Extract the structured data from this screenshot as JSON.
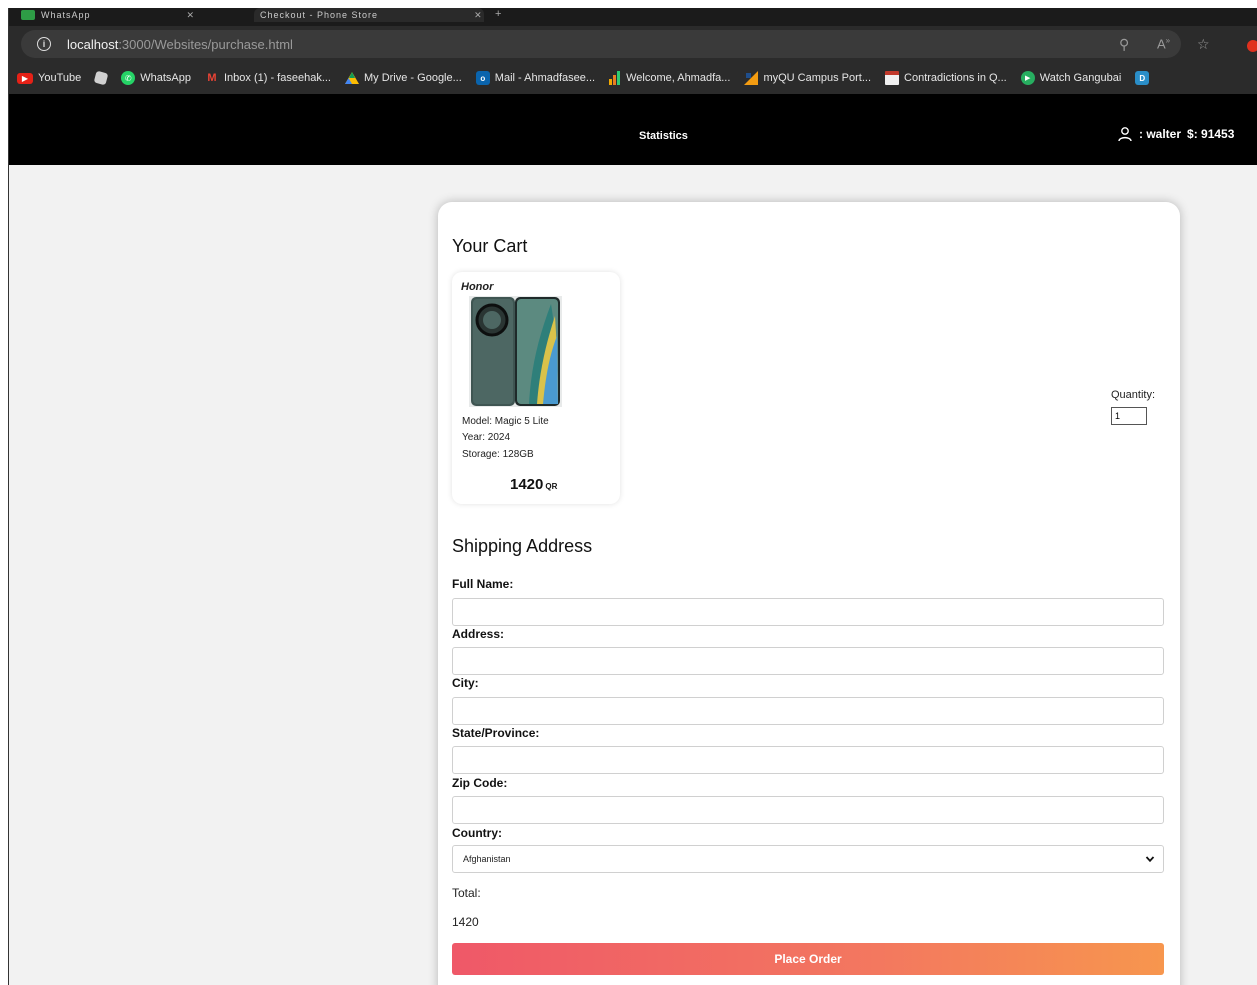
{
  "browser": {
    "tabs": [
      {
        "title": "WhatsApp"
      },
      {
        "title": "Checkout - Phone Store"
      }
    ],
    "url_host": "localhost",
    "url_path": ":3000/Websites/purchase.html",
    "bookmarks": [
      {
        "label": "YouTube",
        "icon": "youtube-icon",
        "color": "#e62117"
      },
      {
        "label": "",
        "icon": "roblox-icon",
        "color": "#d0d0d0"
      },
      {
        "label": "WhatsApp",
        "icon": "whatsapp-icon",
        "color": "#25d366"
      },
      {
        "label": "Inbox (1) - faseehak...",
        "icon": "gmail-icon",
        "color": "#ea4335"
      },
      {
        "label": "My Drive - Google...",
        "icon": "drive-icon",
        "color": "#fbbc04"
      },
      {
        "label": "Mail - Ahmadfasee...",
        "icon": "outlook-icon",
        "color": "#0a64ad"
      },
      {
        "label": "Welcome, Ahmadfa...",
        "icon": "chart-icon",
        "color": "#f2a900"
      },
      {
        "label": "myQU Campus Port...",
        "icon": "campus-icon",
        "color": "#f39c12"
      },
      {
        "label": "Contradictions in Q...",
        "icon": "doc-icon",
        "color": "#c0392b"
      },
      {
        "label": "Watch Gangubai",
        "icon": "play-icon",
        "color": "#27ae60"
      },
      {
        "label": "",
        "icon": "d-icon",
        "color": "#2a8ec8"
      }
    ]
  },
  "header": {
    "nav_statistics": "Statistics",
    "username": ": walter",
    "balance": "$: 91453"
  },
  "cart": {
    "title": "Your Cart",
    "item": {
      "brand": "Honor",
      "model": "Model: Magic 5 Lite",
      "year": "Year: 2024",
      "storage": "Storage: 128GB",
      "price": "1420",
      "currency": "QR"
    },
    "quantity_label": "Quantity:",
    "quantity_value": "1"
  },
  "shipping": {
    "title": "Shipping Address",
    "full_name_label": "Full Name:",
    "address_label": "Address:",
    "city_label": "City:",
    "state_label": "State/Province:",
    "zip_label": "Zip Code:",
    "country_label": "Country:",
    "country_value": "Afghanistan",
    "total_label": "Total:",
    "total_value": "1420",
    "place_order_label": "Place Order"
  }
}
